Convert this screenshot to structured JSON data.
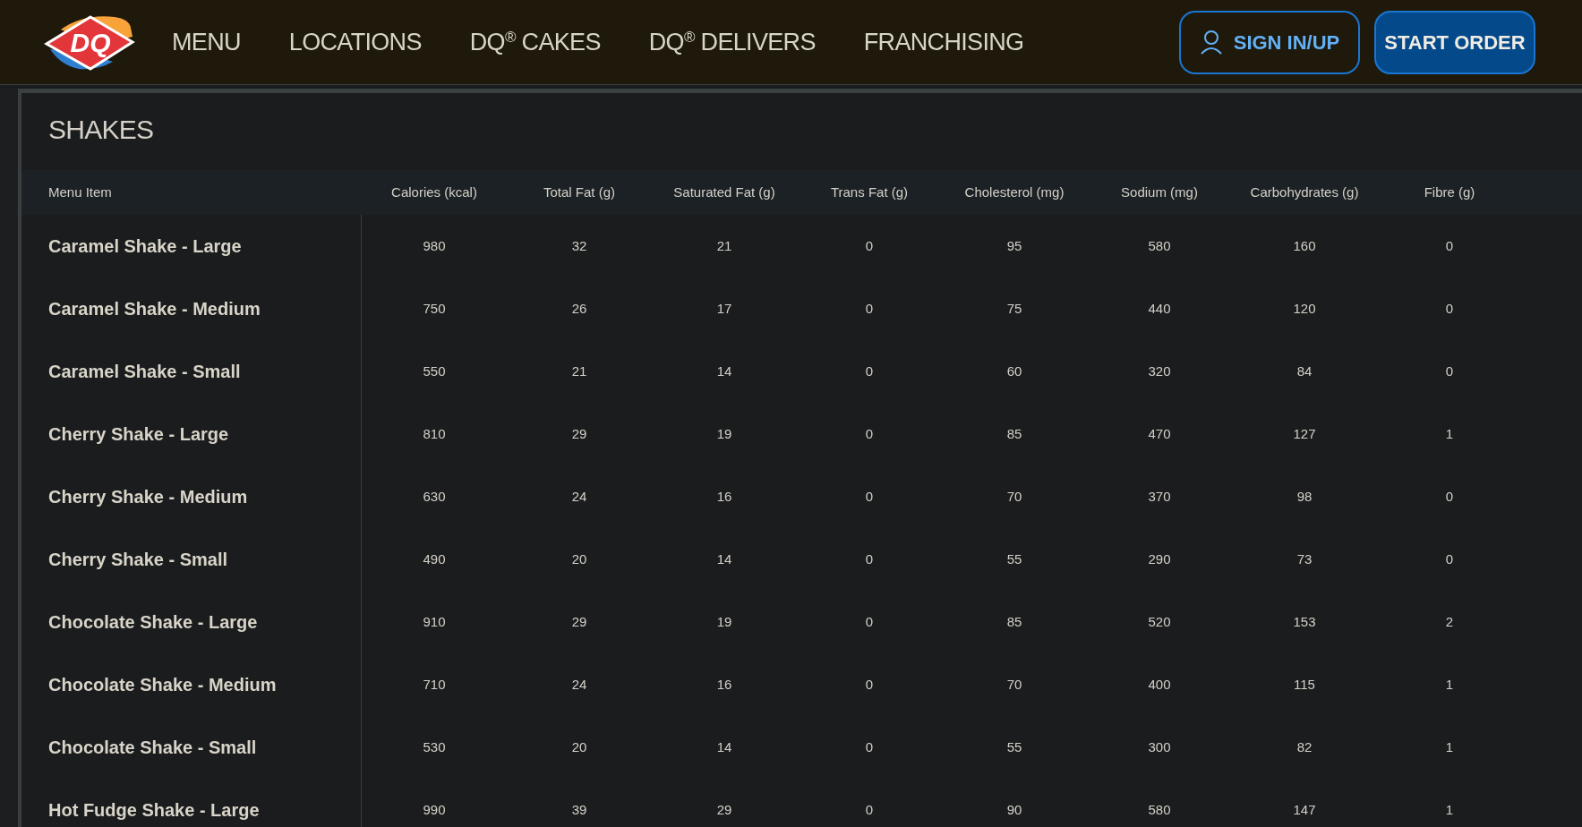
{
  "header": {
    "logo": {
      "text": "DQ"
    },
    "nav": [
      {
        "label": "MENU"
      },
      {
        "label": "LOCATIONS"
      },
      {
        "label": "DQ$^{®}$ CAKES"
      },
      {
        "label": "DQ$^{®}$ DELIVERS"
      },
      {
        "label": "FRANCHISING"
      }
    ],
    "sign_in": "SIGN IN/UP",
    "start_order": "START ORDER"
  },
  "section": {
    "title": "SHAKES",
    "columns": [
      "Menu Item",
      "Calories (kcal)",
      "Total Fat (g)",
      "Saturated Fat (g)",
      "Trans Fat (g)",
      "Cholesterol (mg)",
      "Sodium (mg)",
      "Carbohydrates (g)",
      "Fibre (g)"
    ],
    "rows": [
      [
        "Caramel Shake - Large",
        "980",
        "32",
        "21",
        "0",
        "95",
        "580",
        "160",
        "0"
      ],
      [
        "Caramel Shake - Medium",
        "750",
        "26",
        "17",
        "0",
        "75",
        "440",
        "120",
        "0"
      ],
      [
        "Caramel Shake - Small",
        "550",
        "21",
        "14",
        "0",
        "60",
        "320",
        "84",
        "0"
      ],
      [
        "Cherry Shake - Large",
        "810",
        "29",
        "19",
        "0",
        "85",
        "470",
        "127",
        "1"
      ],
      [
        "Cherry Shake - Medium",
        "630",
        "24",
        "16",
        "0",
        "70",
        "370",
        "98",
        "0"
      ],
      [
        "Cherry Shake - Small",
        "490",
        "20",
        "14",
        "0",
        "55",
        "290",
        "73",
        "0"
      ],
      [
        "Chocolate Shake - Large",
        "910",
        "29",
        "19",
        "0",
        "85",
        "520",
        "153",
        "2"
      ],
      [
        "Chocolate Shake - Medium",
        "710",
        "24",
        "16",
        "0",
        "70",
        "400",
        "115",
        "1"
      ],
      [
        "Chocolate Shake - Small",
        "530",
        "20",
        "14",
        "0",
        "55",
        "300",
        "82",
        "1"
      ],
      [
        "Hot Fudge Shake - Large",
        "990",
        "39",
        "29",
        "0",
        "90",
        "580",
        "147",
        "1"
      ]
    ]
  }
}
